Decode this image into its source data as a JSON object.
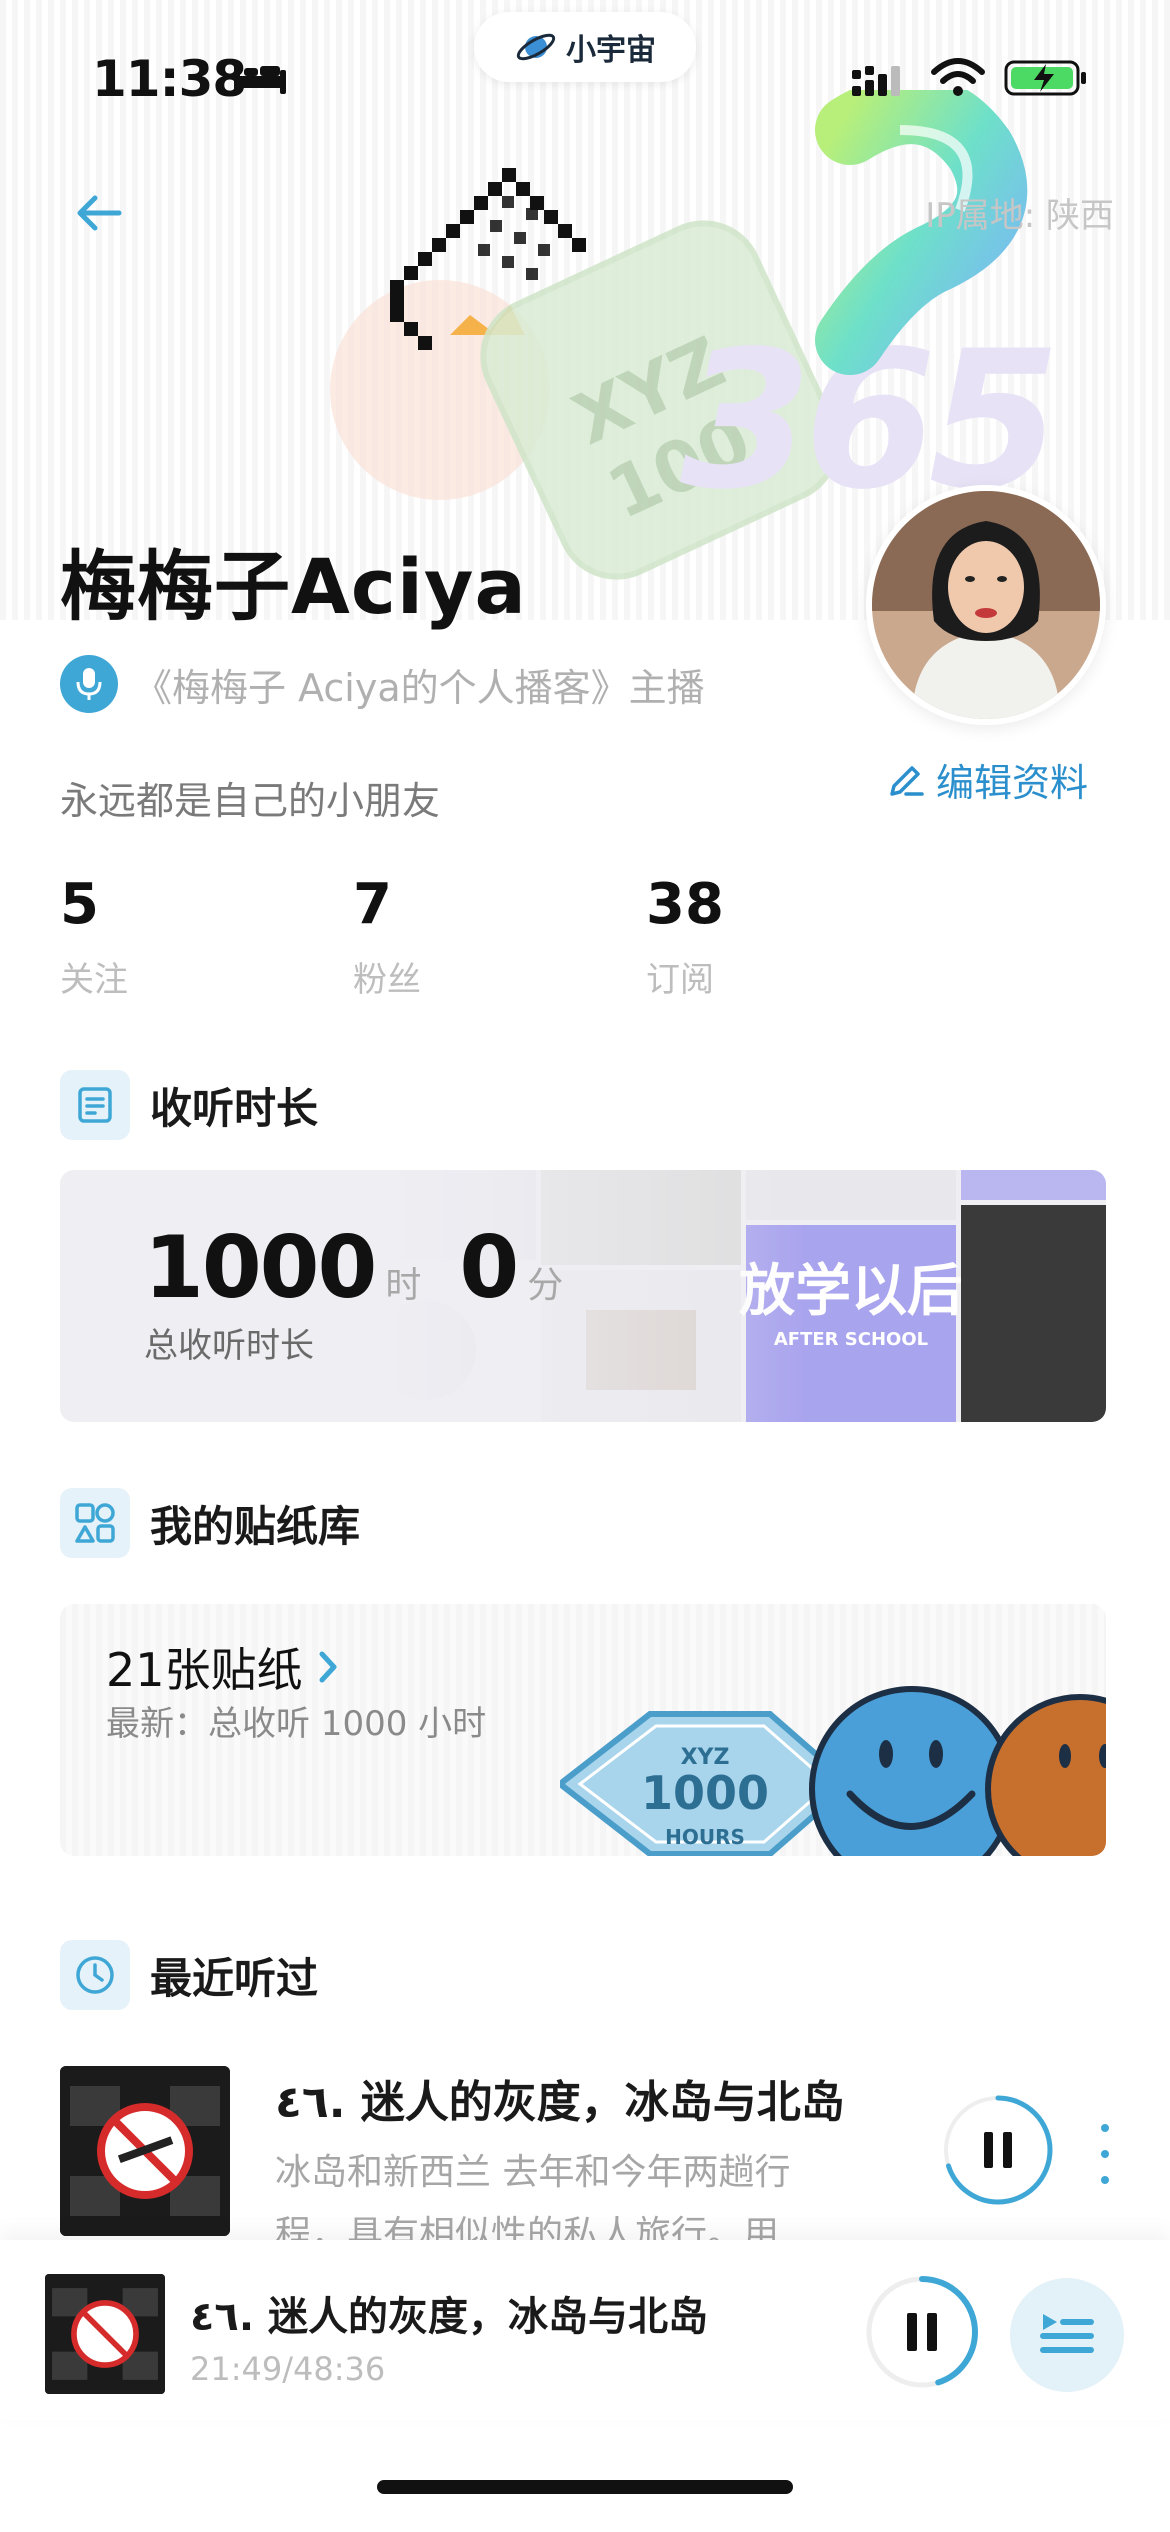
{
  "status_bar": {
    "time": "11:38",
    "center_label": "小宇宙"
  },
  "header": {
    "ip_location": "IP属地: 陕西"
  },
  "profile": {
    "name": "梅梅子Aciya",
    "podcast_role": "《梅梅子 Aciya的个人播客》主播",
    "bio": "永远都是自己的小朋友",
    "edit_label": "编辑资料",
    "stats": [
      {
        "value": "5",
        "label": "关注"
      },
      {
        "value": "7",
        "label": "粉丝"
      },
      {
        "value": "38",
        "label": "订阅"
      }
    ]
  },
  "listening": {
    "section_title": "收听时长",
    "hours": "1000",
    "hours_unit": "时",
    "minutes": "0",
    "minutes_unit": "分",
    "label": "总收听时长",
    "collage_text": "放学以后",
    "collage_sub": "AFTER SCHOOL"
  },
  "stickers": {
    "section_title": "我的贴纸库",
    "count_label": "21张贴纸",
    "latest_label": "最新：总收听 1000 小时",
    "badge_top": "XYZ",
    "badge_mid": "1000",
    "badge_bottom": "HOURS"
  },
  "recent": {
    "section_title": "最近听过",
    "episode": {
      "title": "٤٦. 迷人的灰度，冰岛与北岛",
      "description": "冰岛和新西兰 去年和今年两趟行程，具有相似性的私人旅行。用…",
      "progress": 0.7
    }
  },
  "player": {
    "title": "٤٦. 迷人的灰度，冰岛与北岛",
    "time": "21:49/48:36",
    "progress": 0.45
  },
  "colors": {
    "accent": "#3fa7d6",
    "edit_blue": "#2a8fcc"
  }
}
